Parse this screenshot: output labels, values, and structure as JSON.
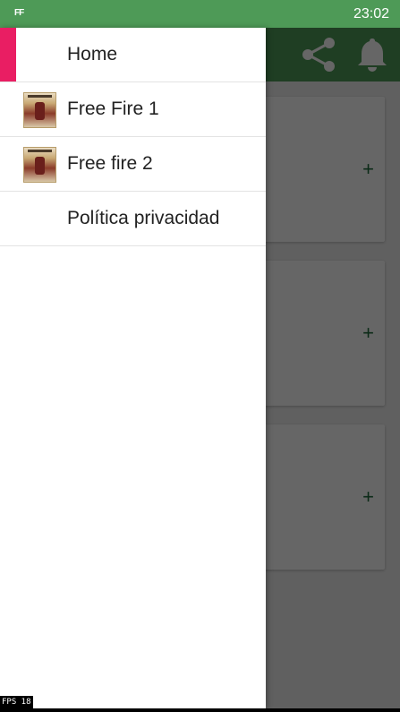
{
  "status_bar": {
    "app_icon": "FF",
    "time": "23:02"
  },
  "toolbar": {
    "share_icon": "share-icon",
    "notification_icon": "bell-icon"
  },
  "cards": [
    {
      "action": "+"
    },
    {
      "action": "+"
    },
    {
      "action": "+"
    }
  ],
  "drawer": {
    "items": [
      {
        "label": "Home",
        "active": true
      },
      {
        "label": "Free Fire 1",
        "thumbnail": "free-fire-thumbnail"
      },
      {
        "label": "Free fire 2",
        "thumbnail": "free-fire-thumbnail"
      },
      {
        "label": "Política privacidad"
      }
    ]
  },
  "overlay": {
    "fps_text": "FPS 18"
  },
  "colors": {
    "status_bar": "#4e9a57",
    "toolbar": "#4f9c58",
    "accent": "#e91e63"
  }
}
